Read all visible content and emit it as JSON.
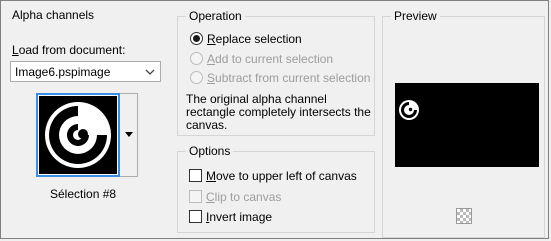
{
  "alpha_channels": {
    "title": "Alpha channels",
    "load_from_label_prefix": "",
    "load_from_label_access": "L",
    "load_from_label_rest": "oad from document:",
    "document_value": "Image6.pspimage",
    "selection_caption": "Sélection #8"
  },
  "operation": {
    "title": "Operation",
    "options": [
      {
        "access": "R",
        "rest": "eplace selection",
        "checked": true,
        "enabled": true
      },
      {
        "access": "A",
        "rest": "dd to current selection",
        "checked": false,
        "enabled": false
      },
      {
        "access": "S",
        "rest": "ubtract from current selection",
        "checked": false,
        "enabled": false
      }
    ],
    "info_line1": "The original alpha channel",
    "info_line2": "rectangle completely intersects the",
    "info_line3": "canvas."
  },
  "options": {
    "title": "Options",
    "items": [
      {
        "access": "M",
        "rest": "ove to upper left of canvas",
        "checked": false,
        "enabled": true
      },
      {
        "access": "C",
        "rest": "lip to canvas",
        "checked": false,
        "enabled": false
      },
      {
        "access": "I",
        "rest": "nvert image",
        "checked": false,
        "enabled": true
      }
    ]
  },
  "preview": {
    "title": "Preview"
  }
}
